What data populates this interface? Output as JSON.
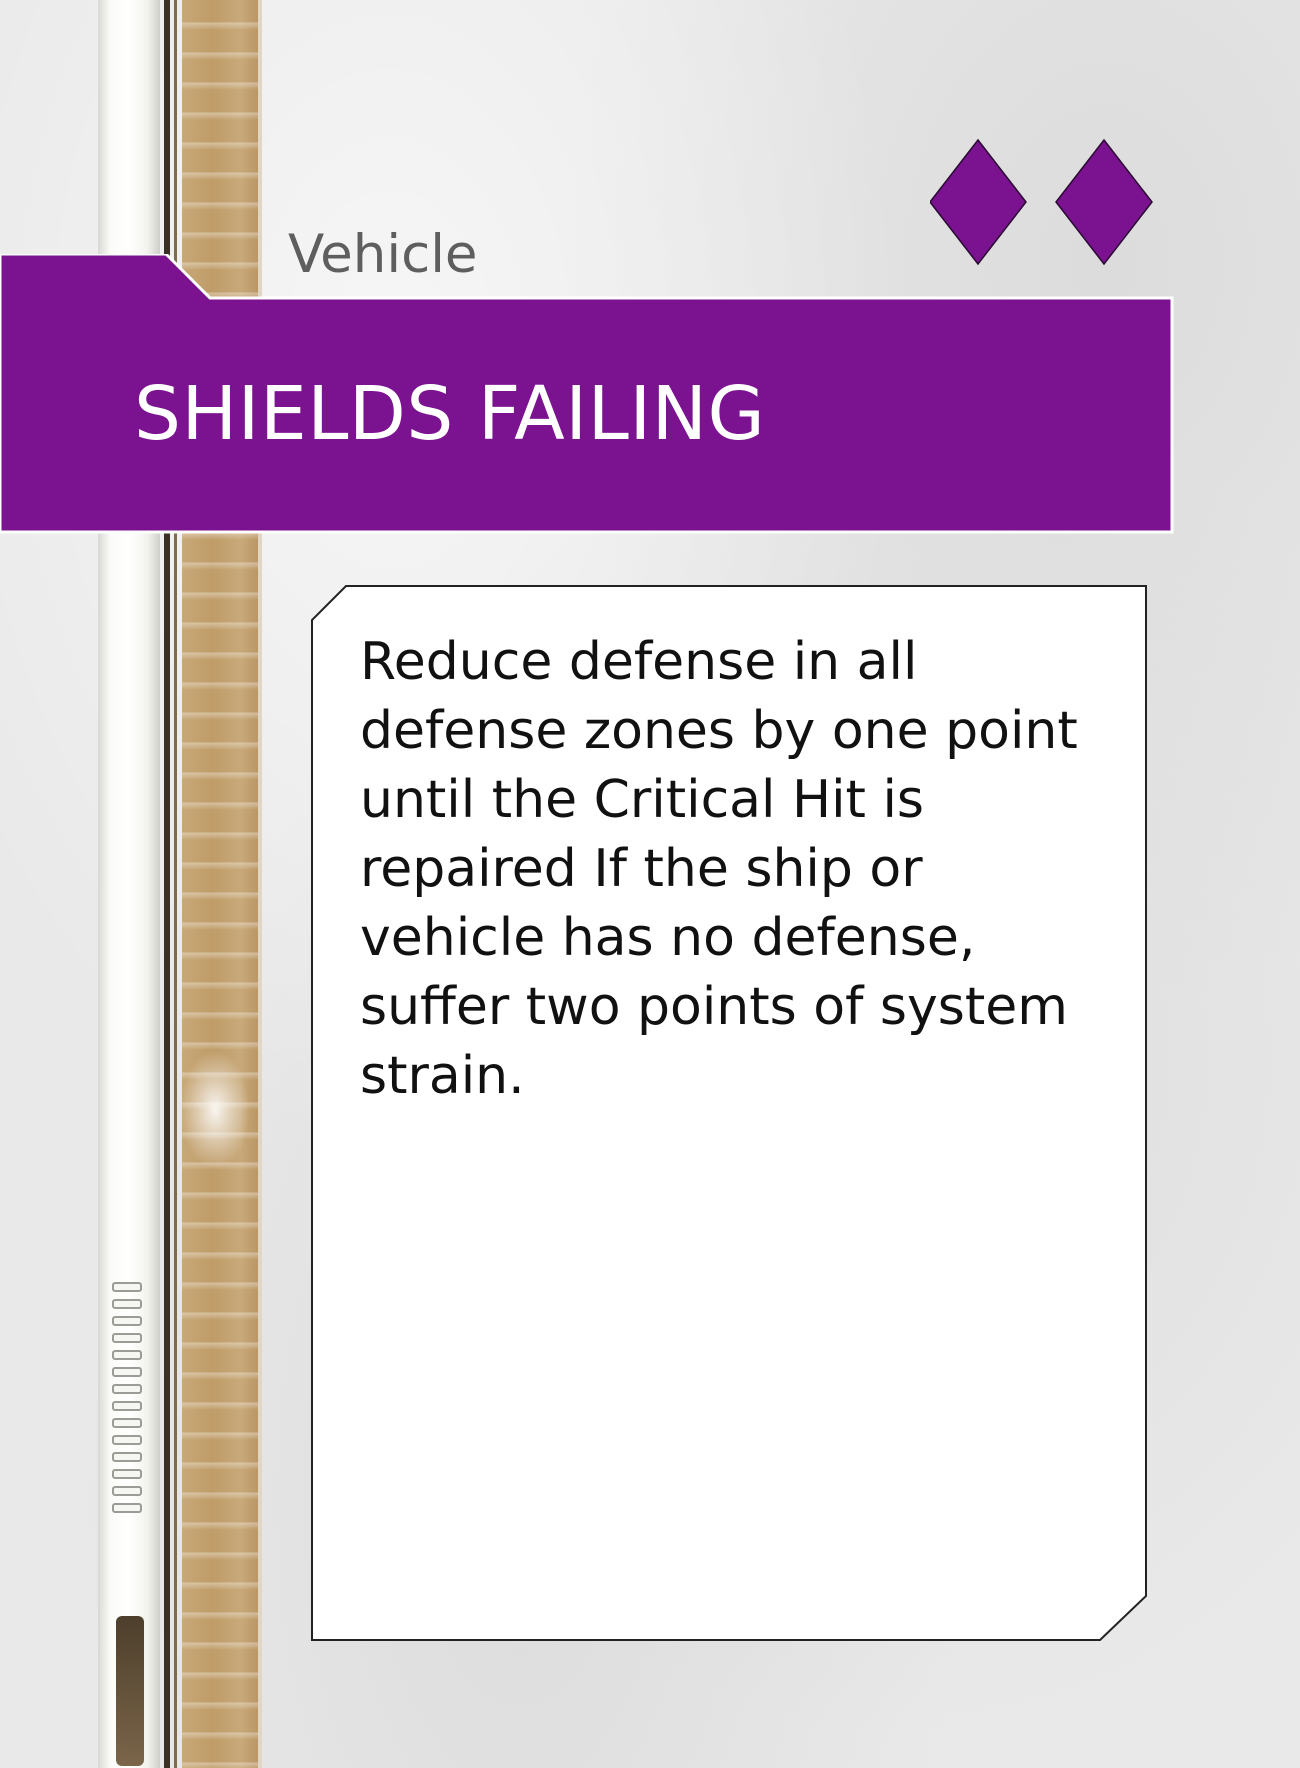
{
  "card": {
    "category": "Vehicle",
    "title": "SHIELDS FAILING",
    "description": "Reduce defense in all defense zones by one point until the Critical Hit is repaired If the ship or vehicle has no defense, suffer two points of system strain.",
    "difficulty_diamonds": 2,
    "colors": {
      "banner": "#7b1290",
      "diamond": "#7b1290",
      "background": "#e9e9e9",
      "text_box": "#ffffff"
    }
  }
}
